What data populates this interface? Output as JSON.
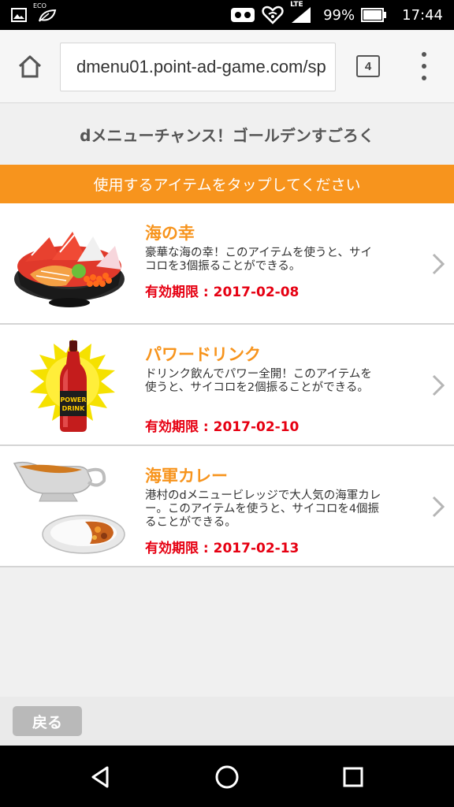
{
  "status_bar": {
    "battery_percent": "99%",
    "time": "17:44",
    "network": "LTE",
    "eco_label": "ECO",
    "icons": [
      "image-icon",
      "eco-leaf-icon",
      "vr-icon",
      "heart-wifi-icon",
      "signal-icon",
      "battery-icon"
    ]
  },
  "browser": {
    "url": "dmenu01.point-ad-game.com/sp",
    "tab_count": "4",
    "icons": [
      "home-icon",
      "tabs-icon",
      "overflow-menu-icon"
    ]
  },
  "page": {
    "title": "dメニューチャンス！ゴールデンすごろく",
    "instruction": "使用するアイテムをタップしてください"
  },
  "items": [
    {
      "name": "海の幸",
      "description": "豪華な海の幸！このアイテムを使うと、サイコロを3個振ることができる。",
      "expiry": "有効期限 : 2017-02-08",
      "image": "seafood-bowl-image"
    },
    {
      "name": "パワードリンク",
      "description": "ドリンク飲んでパワー全開！このアイテムを使うと、サイコロを2個振ることができる。",
      "expiry": "有効期限 : 2017-02-10",
      "image": "power-drink-image",
      "bottle_label": "POWER DRINK"
    },
    {
      "name": "海軍カレー",
      "description": "港村のdメニュービレッジで大人気の海軍カレー。このアイテムを使うと、サイコロを4個振ることができる。",
      "expiry": "有効期限 : 2017-02-13",
      "image": "navy-curry-image"
    }
  ],
  "back_button": "戻る",
  "colors": {
    "accent_orange": "#f7941d",
    "expiry_red": "#e60012",
    "back_button_gray": "#b9b9b9"
  }
}
